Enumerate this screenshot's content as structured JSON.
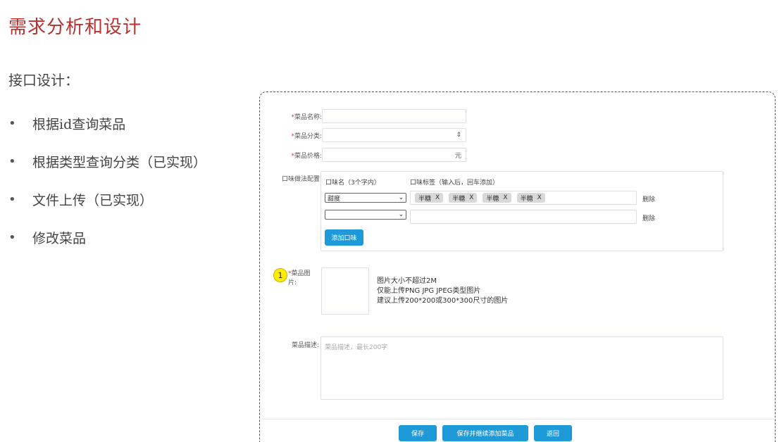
{
  "slide": {
    "title": "需求分析和设计",
    "subtitle": "接口设计：",
    "bullet_symbol": "•",
    "bullets": [
      "根据id查询菜品",
      "根据类型查询分类（已实现）",
      "文件上传（已实现）",
      "修改菜品"
    ]
  },
  "form": {
    "required_mark": "*",
    "name_label": "菜品名称:",
    "category_label": "菜品分类:",
    "category_arrow": "⇕",
    "price_label": "菜品价格:",
    "price_unit": "元",
    "flavor_label": "口味做法配置:",
    "flavor_name_header": "口味名（3个字内）",
    "flavor_tags_header": "口味标签（输入后，回车添加）",
    "flavor_rows": [
      {
        "name": "甜度",
        "tags": [
          "半糖",
          "半糖",
          "半糖",
          "半糖"
        ],
        "delete": "删除"
      },
      {
        "name": "",
        "tags": [],
        "delete": "删除"
      }
    ],
    "tag_close": "X",
    "add_flavor_button": "添加口味",
    "image_label": "菜品图片:",
    "image_badge": "1",
    "image_hints": [
      "图片大小不超过2M",
      "仅能上传PNG JPG JPEG类型图片",
      "建议上传200*200或300*300尺寸的图片"
    ],
    "desc_label": "菜品描述:",
    "desc_placeholder": "菜品描述，最长200字",
    "save_button": "保存",
    "save_continue_button": "保存并继续添加菜品",
    "back_button": "返回"
  }
}
